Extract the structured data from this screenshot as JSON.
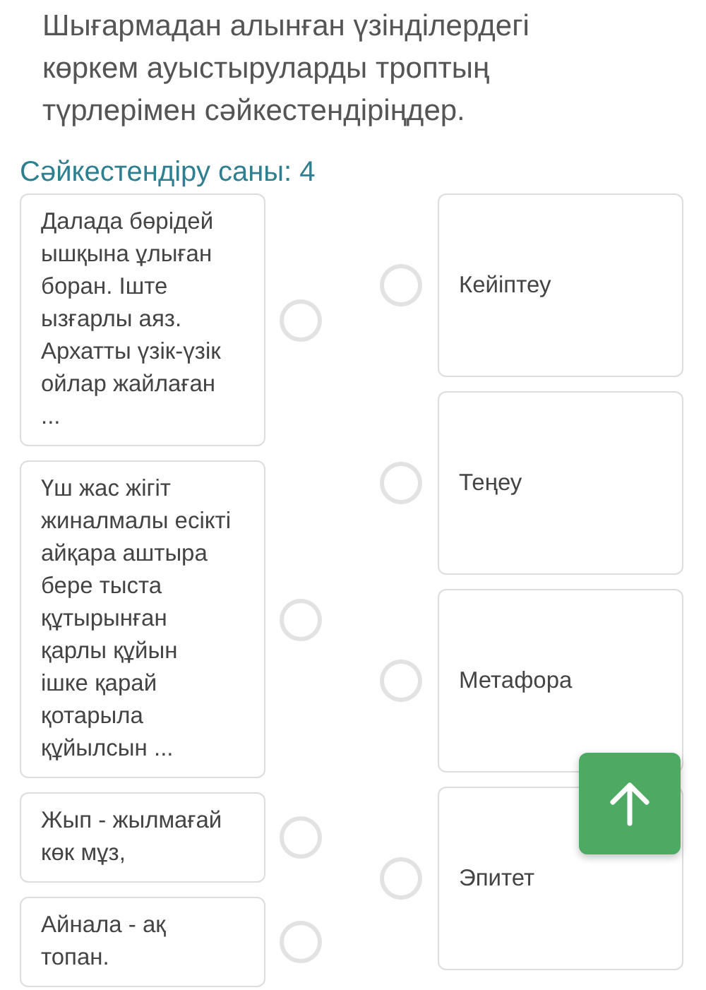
{
  "question": "Шығармадан алынған үзінділердегі көркем ауыстыруларды троптың түрлерімен сәйкестендіріңдер.",
  "match_count": "Сәйкестендіру саны: 4",
  "left_items": [
    {
      "text": "Далада бөрідей\nышқына ұлыған\nборан. Іште\nызғарлы аяз.\nАрхатты үзік-үзік\nойлар жайлаған\n...",
      "selected": false
    },
    {
      "text": "Үш жас жігіт\nжиналмалы есікті\nайқара аштыра\nбере тыста\nқұтырынған\nқарлы құйын\nішке қарай\nқотарыла\nқұйылсын ...",
      "selected": false
    },
    {
      "text": "Жып - жылмағай\nкөк мұз,",
      "selected": false
    },
    {
      "text": "Айнала - ақ\nтопан.",
      "selected": false
    }
  ],
  "right_items": [
    {
      "text": "Кейіптеу",
      "selected": false
    },
    {
      "text": "Теңеу",
      "selected": false
    },
    {
      "text": "Метафора",
      "selected": false
    },
    {
      "text": "Эпитет",
      "selected": false
    }
  ]
}
